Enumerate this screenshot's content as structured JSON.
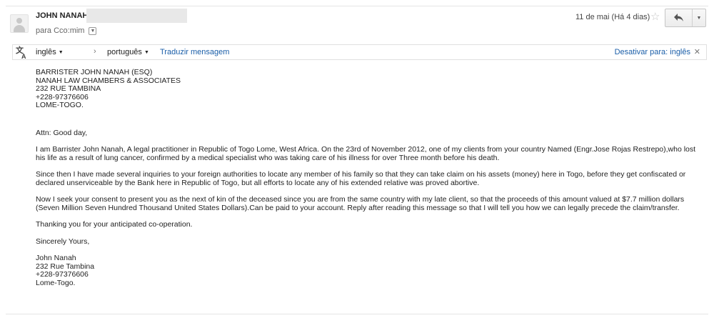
{
  "header": {
    "sender_name": "JOHN NANAH",
    "recipient": "para Cco:mim",
    "date": "11 de mai (Há 4 dias)"
  },
  "translate_bar": {
    "source_lang": "inglês",
    "target_lang": "português",
    "translate_link": "Traduzir mensagem",
    "disable_link": "Desativar para: inglês"
  },
  "message": {
    "address_lines": [
      "BARRISTER JOHN NANAH (ESQ)",
      "NANAH LAW CHAMBERS & ASSOCIATES",
      "232 RUE TAMBINA",
      "+228-97376606",
      "LOME-TOGO."
    ],
    "greeting": "Attn: Good day,",
    "paragraphs": [
      "I am Barrister John Nanah, A legal practitioner in Republic of Togo Lome, West Africa. On the 23rd of November 2012, one of my clients from your country Named (Engr.Jose Rojas Restrepo),who lost his life as a result of lung cancer, confirmed by a medical specialist who was taking care of his illness for over Three month before his death.",
      "Since then I have made several inquiries to your foreign authorities to locate any member of his family so that they can take claim on his assets (money) here in Togo, before they get confiscated or declared unserviceable by the Bank here in Republic of Togo, but all efforts to locate any of his extended relative was proved abortive.",
      "Now I seek your consent to present you as the next of kin of the deceased since you are from the same country with my late client, so that the proceeds of this amount valued at $7.7 million dollars (Seven Million Seven Hundred Thousand United States Dollars).Can be paid to your account. Reply after reading this message so that I will tell you how we can legally precede the claim/transfer.",
      "Thanking you for your anticipated co-operation."
    ],
    "closing": "Sincerely Yours,",
    "signature_lines": [
      "John Nanah",
      "232 Rue Tambina",
      "+228-97376606",
      "Lome-Togo."
    ]
  }
}
